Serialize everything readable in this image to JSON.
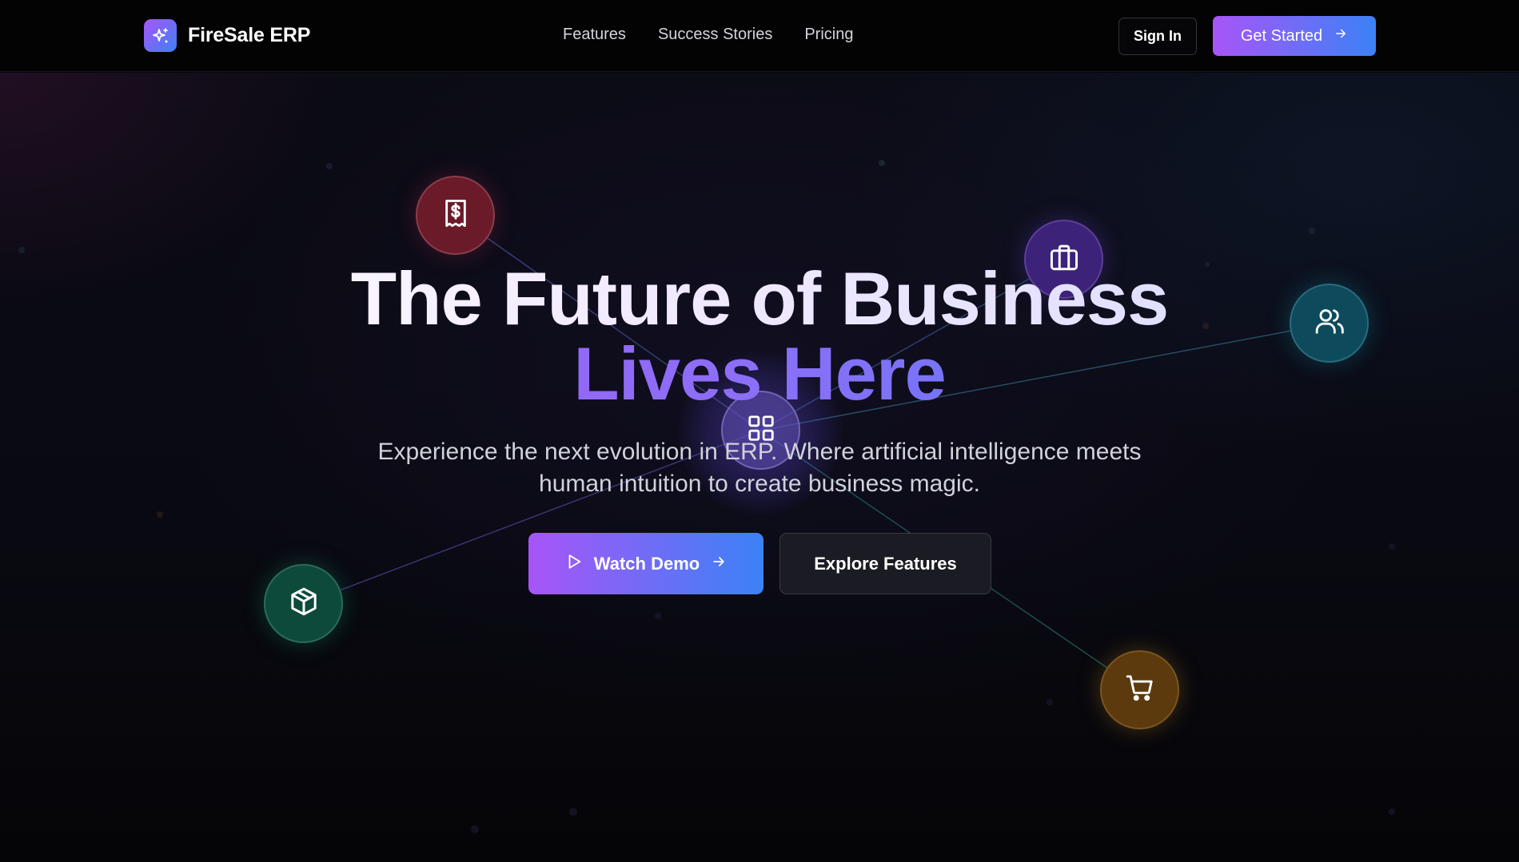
{
  "header": {
    "brand_name": "FireSale ERP",
    "nav": [
      {
        "label": "Features"
      },
      {
        "label": "Success Stories"
      },
      {
        "label": "Pricing"
      }
    ],
    "sign_in_label": "Sign In",
    "get_started_label": "Get Started"
  },
  "hero": {
    "title_line1": "The Future of Business",
    "title_line2": "Lives Here",
    "subtitle": "Experience the next evolution in ERP. Where artificial intelligence meets human intuition to create business magic.",
    "watch_demo_label": "Watch Demo",
    "explore_features_label": "Explore Features"
  },
  "nodes": [
    {
      "icon": "receipt-dollar-icon",
      "color": "#6b1a2a"
    },
    {
      "icon": "briefcase-icon",
      "color": "#3c2278"
    },
    {
      "icon": "users-icon",
      "color": "#0c4a5c"
    },
    {
      "icon": "layout-grid-icon",
      "color": "#5f50b4"
    },
    {
      "icon": "package-icon",
      "color": "#0d4a3c"
    },
    {
      "icon": "shopping-cart-icon",
      "color": "#5c3a0e"
    }
  ],
  "colors": {
    "accent_purple": "#a855f7",
    "accent_blue": "#3b82f6",
    "background": "#07070c"
  }
}
